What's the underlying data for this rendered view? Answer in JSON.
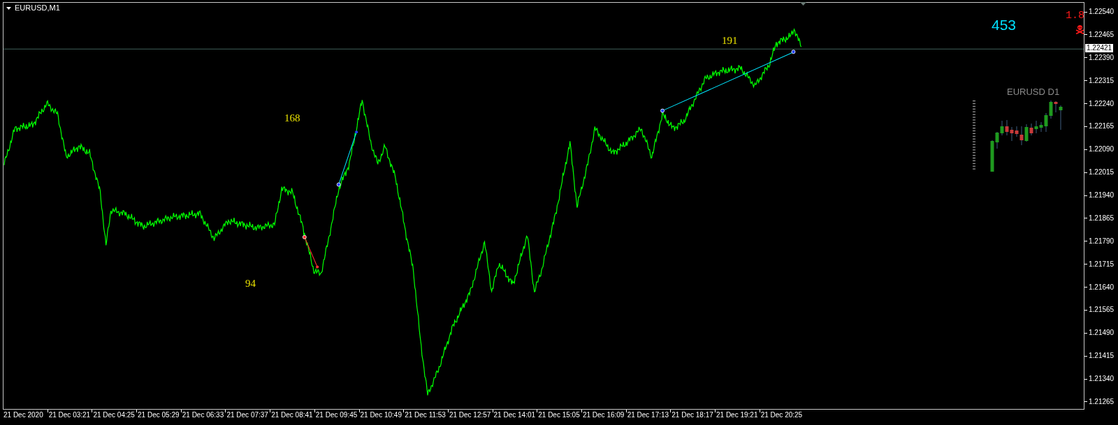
{
  "chart": {
    "title": "EURUSD,M1",
    "annotations": [
      {
        "text": "168"
      },
      {
        "text": "94"
      },
      {
        "text": "191"
      }
    ],
    "counter": "453",
    "spread": "1.8",
    "inset": {
      "title": "EURUSD D1"
    }
  },
  "price_axis": {
    "labels": [
      "1.22540",
      "1.22465",
      "1.22390",
      "1.22315",
      "1.22240",
      "1.22165",
      "1.22090",
      "1.22015",
      "1.21940",
      "1.21865",
      "1.21790",
      "1.21715",
      "1.21640",
      "1.21565",
      "1.21490",
      "1.21415",
      "1.21340",
      "1.21265"
    ],
    "current_price": "1.22421"
  },
  "time_axis": {
    "labels": [
      "21 Dec 2020",
      "21 Dec 03:21",
      "21 Dec 04:25",
      "21 Dec 05:29",
      "21 Dec 06:33",
      "21 Dec 07:37",
      "21 Dec 08:41",
      "21 Dec 09:45",
      "21 Dec 10:49",
      "21 Dec 11:53",
      "21 Dec 12:57",
      "21 Dec 14:01",
      "21 Dec 15:05",
      "21 Dec 16:09",
      "21 Dec 17:13",
      "21 Dec 18:17",
      "21 Dec 19:21",
      "21 Dec 20:25"
    ]
  }
}
